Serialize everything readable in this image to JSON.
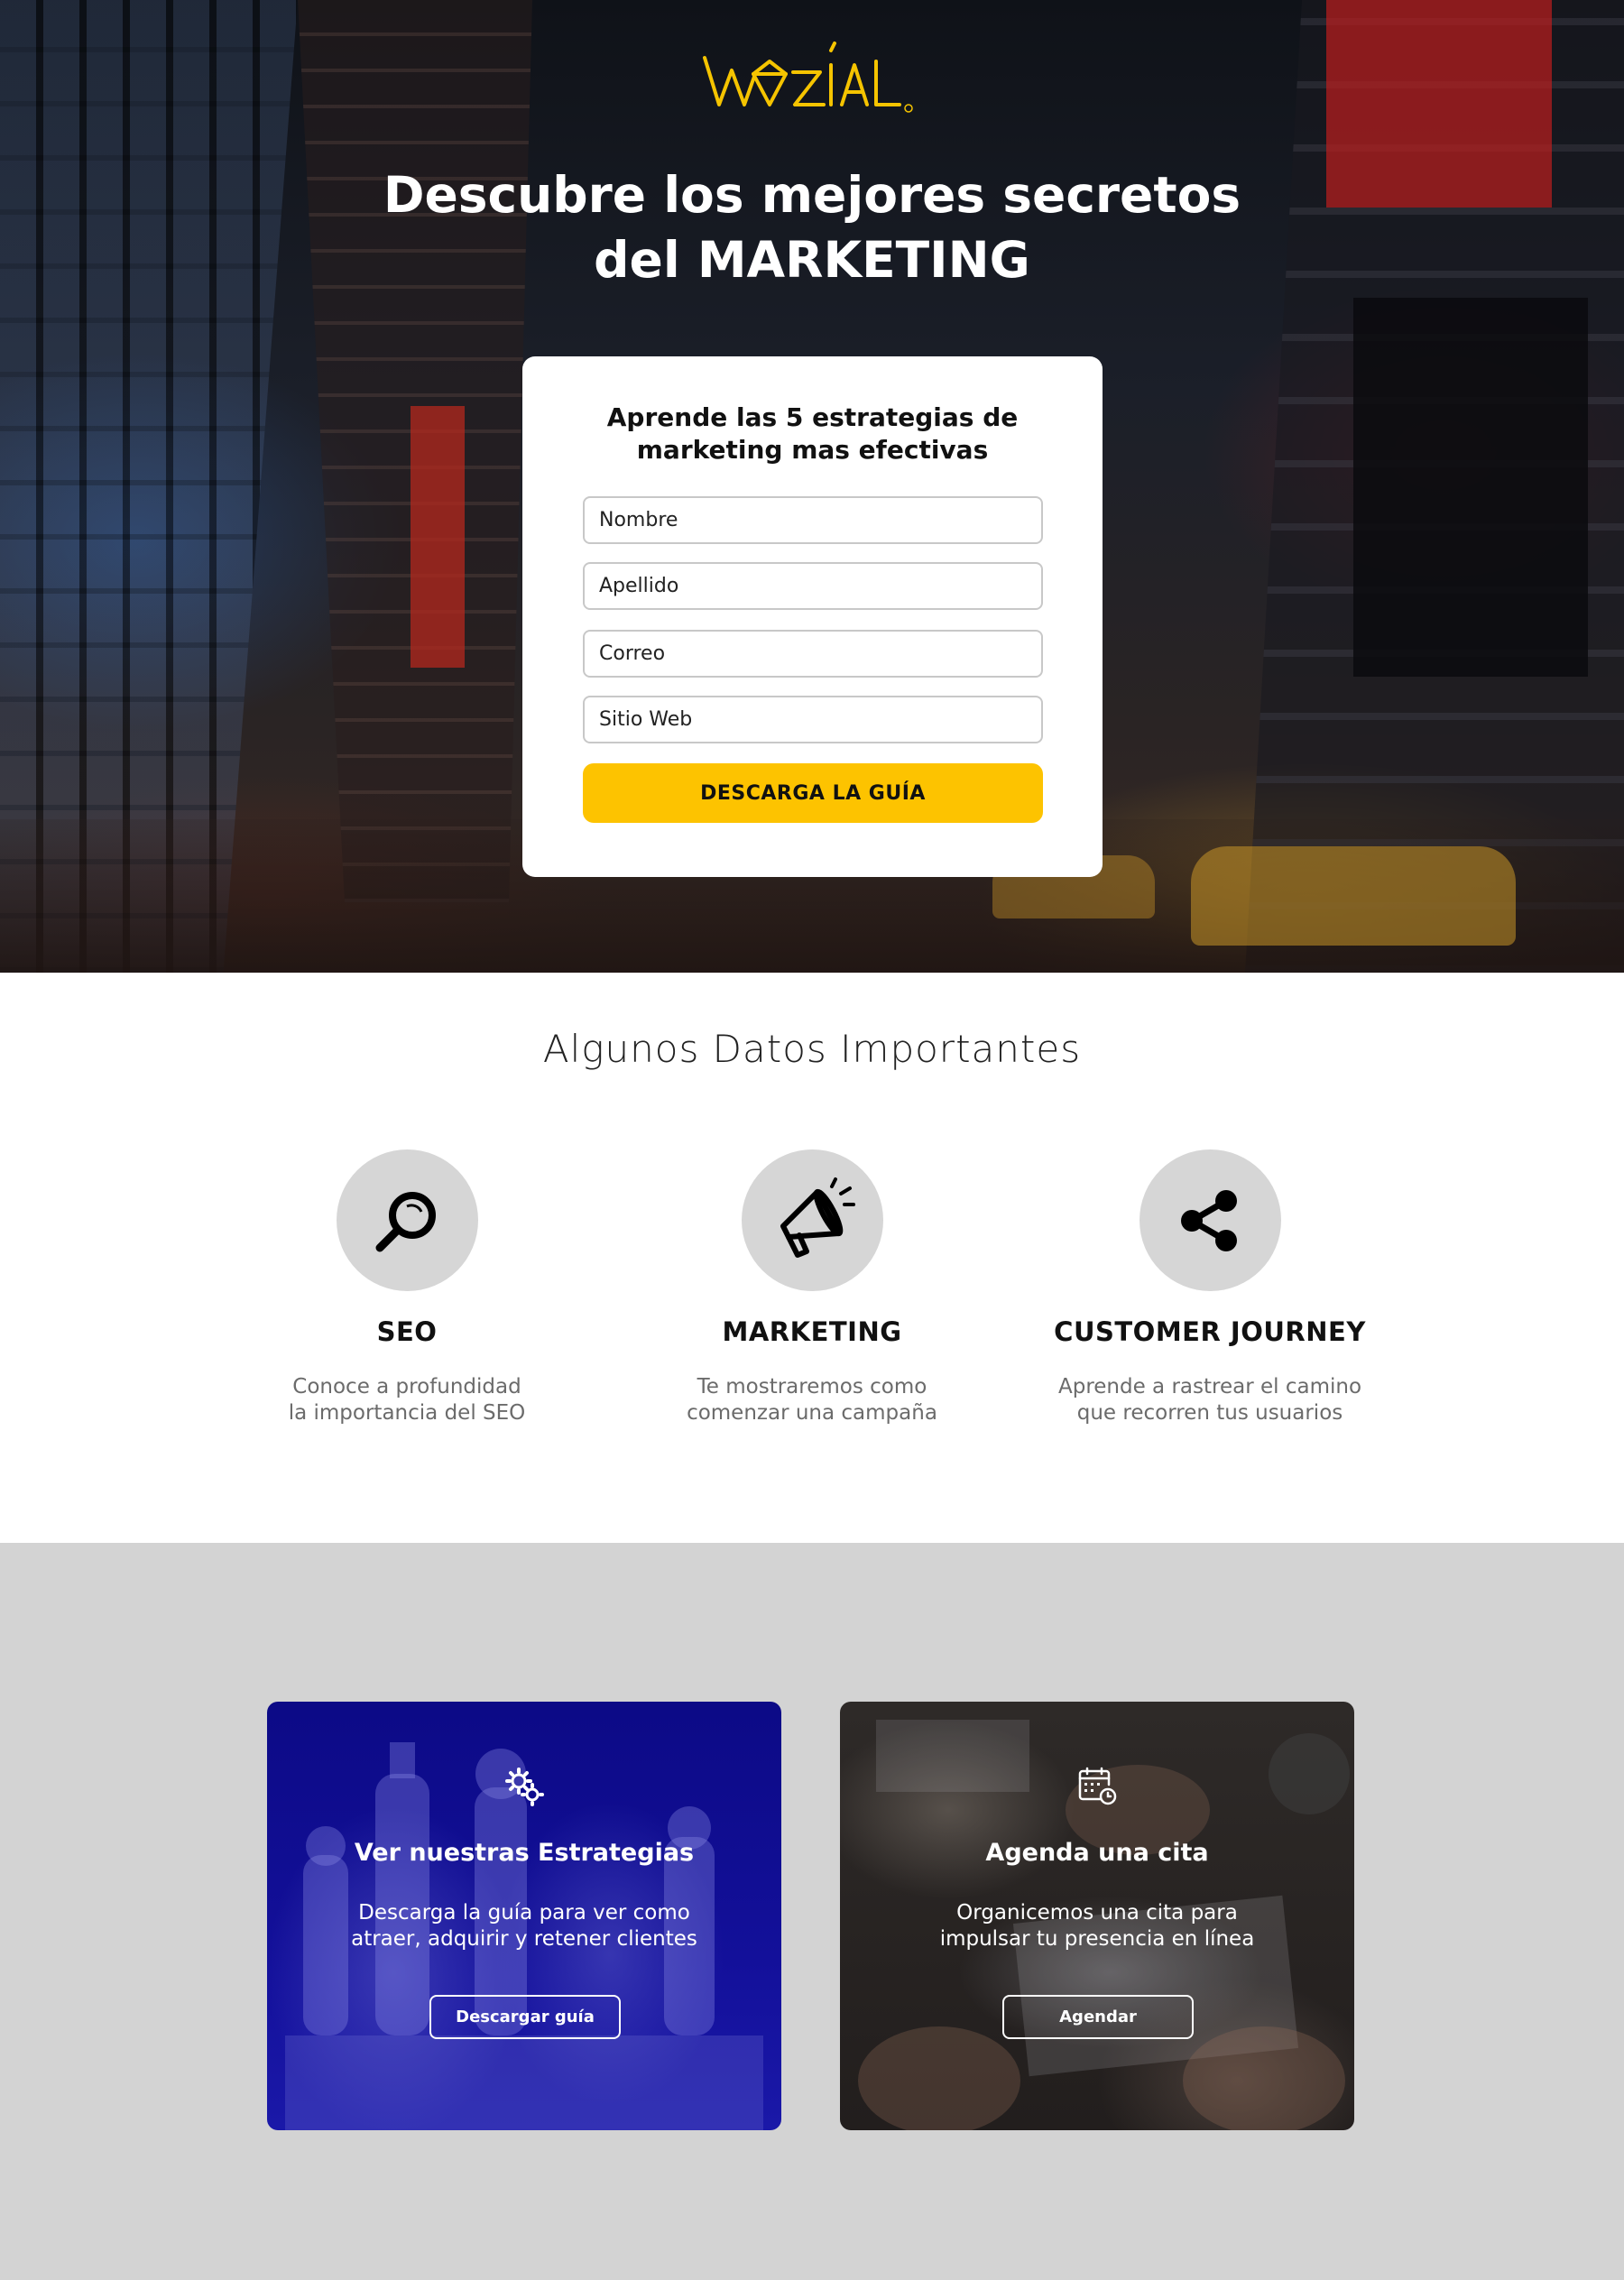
{
  "hero": {
    "logo_text": "WOZIAL",
    "title_line1": "Descubre los mejores secretos",
    "title_line2": "del MARKETING"
  },
  "form": {
    "title_line1": "Aprende las 5 estrategias de",
    "title_line2": "marketing mas efectivas",
    "fields": [
      {
        "placeholder": "Nombre",
        "value": ""
      },
      {
        "placeholder": "Apellido",
        "value": ""
      },
      {
        "placeholder": "Correo",
        "value": ""
      },
      {
        "placeholder": "Sitio Web",
        "value": ""
      }
    ],
    "submit_label": "DESCARGA LA GUÍA",
    "submit_color": "#fdc300"
  },
  "datos": {
    "title": "Algunos Datos Importantes",
    "features": [
      {
        "icon": "magnifier-icon",
        "title": "SEO",
        "desc_line1": "Conoce a profundidad",
        "desc_line2": "la importancia del SEO"
      },
      {
        "icon": "megaphone-icon",
        "title": "MARKETING",
        "desc_line1": "Te mostraremos como",
        "desc_line2": "comenzar una campaña"
      },
      {
        "icon": "share-icon",
        "title": "CUSTOMER JOURNEY",
        "desc_line1": "Aprende a rastrear el camino",
        "desc_line2": "que recorren tus usuarios"
      }
    ]
  },
  "cta": {
    "cards": [
      {
        "icon": "gears-icon",
        "title": "Ver nuestras Estrategias",
        "desc_line1": "Descarga la guía para ver  como",
        "desc_line2": "atraer, adquirir y retener clientes",
        "button": "Descargar guía"
      },
      {
        "icon": "calendar-clock-icon",
        "title": "Agenda una cita",
        "desc_line1": "Organicemos una cita para",
        "desc_line2": "impulsar tu presencia en línea",
        "button": "Agendar"
      }
    ]
  },
  "colors": {
    "accent": "#fdc300",
    "cta_blue": "#0c0a86",
    "section_gray": "#d3d3d3"
  }
}
